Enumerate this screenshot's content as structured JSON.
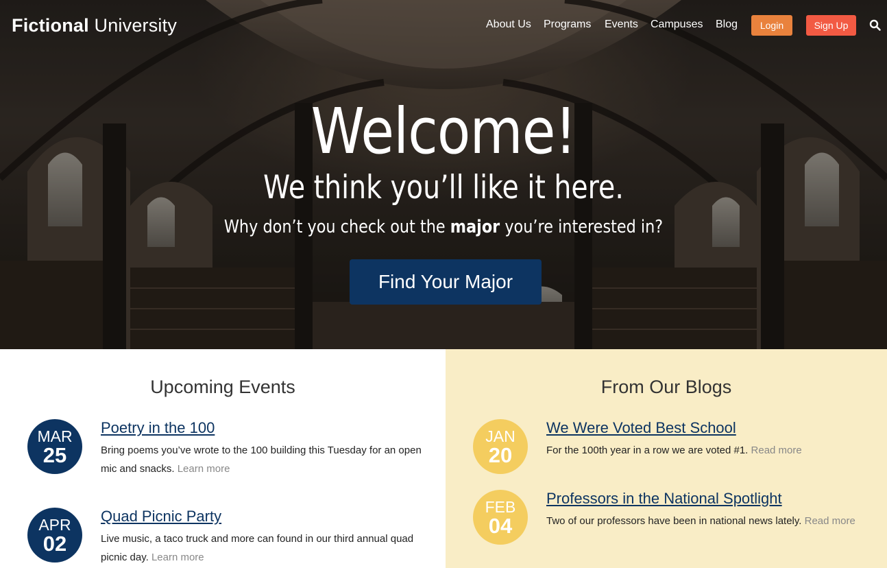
{
  "header": {
    "logo_bold": "Fictional",
    "logo_light": " University",
    "nav": [
      "About Us",
      "Programs",
      "Events",
      "Campuses",
      "Blog"
    ],
    "login_label": "Login",
    "signup_label": "Sign Up"
  },
  "hero": {
    "headline": "Welcome!",
    "subheadline": "We think you’ll like it here.",
    "prompt_before": "Why don’t you check out the ",
    "prompt_bold": "major",
    "prompt_after": " you’re interested in?",
    "cta_label": "Find Your Major"
  },
  "events": {
    "title": "Upcoming Events",
    "items": [
      {
        "month": "MAR",
        "day": "25",
        "title": "Poetry in the 100",
        "desc": "Bring poems you’ve wrote to the 100 building this Tuesday for an open mic and snacks.",
        "more": "Learn more"
      },
      {
        "month": "APR",
        "day": "02",
        "title": "Quad Picnic Party",
        "desc": "Live music, a taco truck and more can found in our third annual quad picnic day.",
        "more": "Learn more"
      }
    ]
  },
  "blogs": {
    "title": "From Our Blogs",
    "items": [
      {
        "month": "JAN",
        "day": "20",
        "title": "We Were Voted Best School",
        "desc": "For the 100th year in a row we are voted #1.",
        "more": "Read more"
      },
      {
        "month": "FEB",
        "day": "04",
        "title": "Professors in the National Spotlight",
        "desc": "Two of our professors have been in national news lately.",
        "more": "Read more"
      }
    ]
  },
  "colors": {
    "navy": "#0d3461",
    "gold": "#f4cd5f",
    "login": "#e9823d",
    "signup": "#f25a43",
    "blog_bg": "#f9edc6"
  },
  "icons": [
    "search-icon"
  ]
}
